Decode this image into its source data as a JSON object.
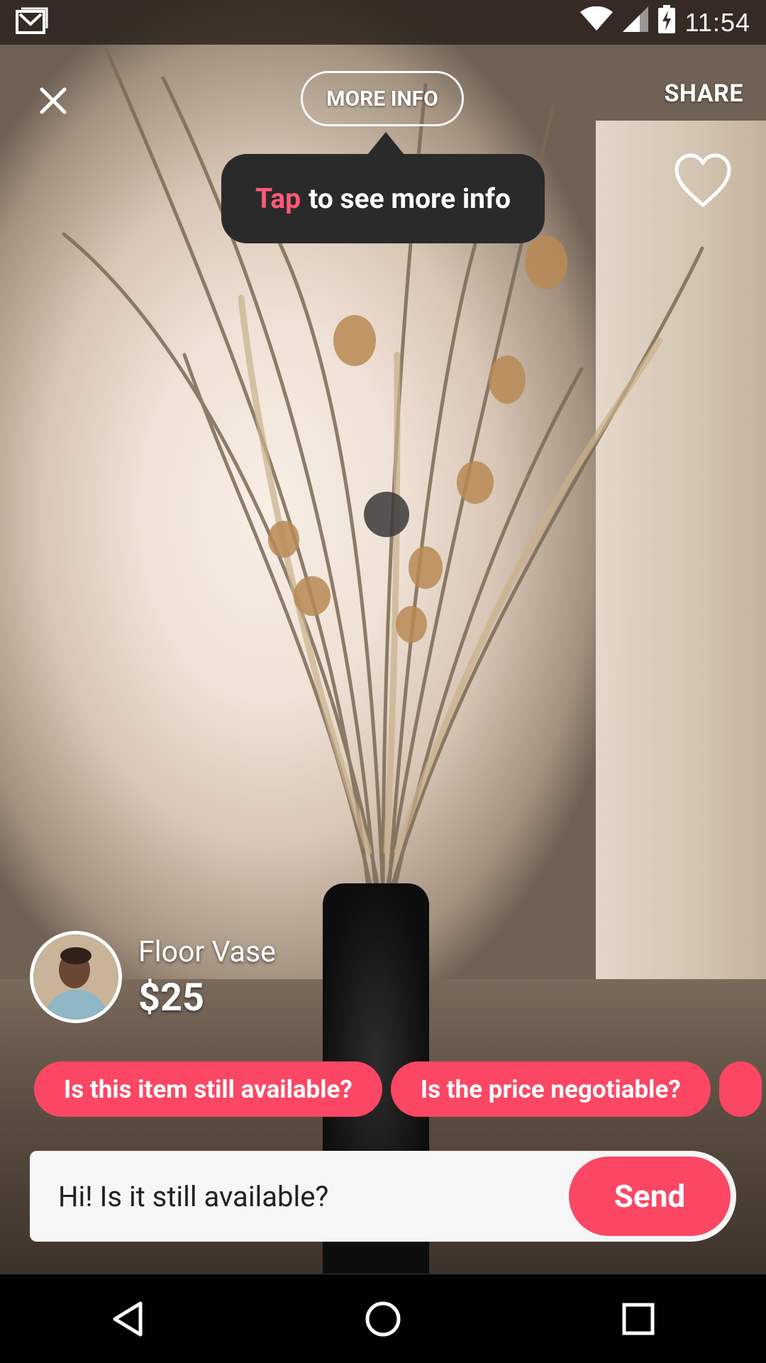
{
  "status_bar": {
    "time": "11:54",
    "icons": [
      "gmail-icon",
      "wifi-icon",
      "signal-icon",
      "battery-charging-icon"
    ]
  },
  "toolbar": {
    "more_info_label": "MORE INFO",
    "share_label": "SHARE"
  },
  "tooltip": {
    "accent": "Tap",
    "rest": "to see more info"
  },
  "listing": {
    "title": "Floor Vase",
    "price": "$25"
  },
  "quick_replies": [
    {
      "label": "Is this item still available?"
    },
    {
      "label": "Is the price negotiable?"
    }
  ],
  "composer": {
    "value": "Hi! Is it still available?",
    "send_label": "Send"
  },
  "colors": {
    "accent": "#fb4764",
    "tooltip_bg": "#2b2a2a",
    "tooltip_accent": "#ff5a76"
  }
}
